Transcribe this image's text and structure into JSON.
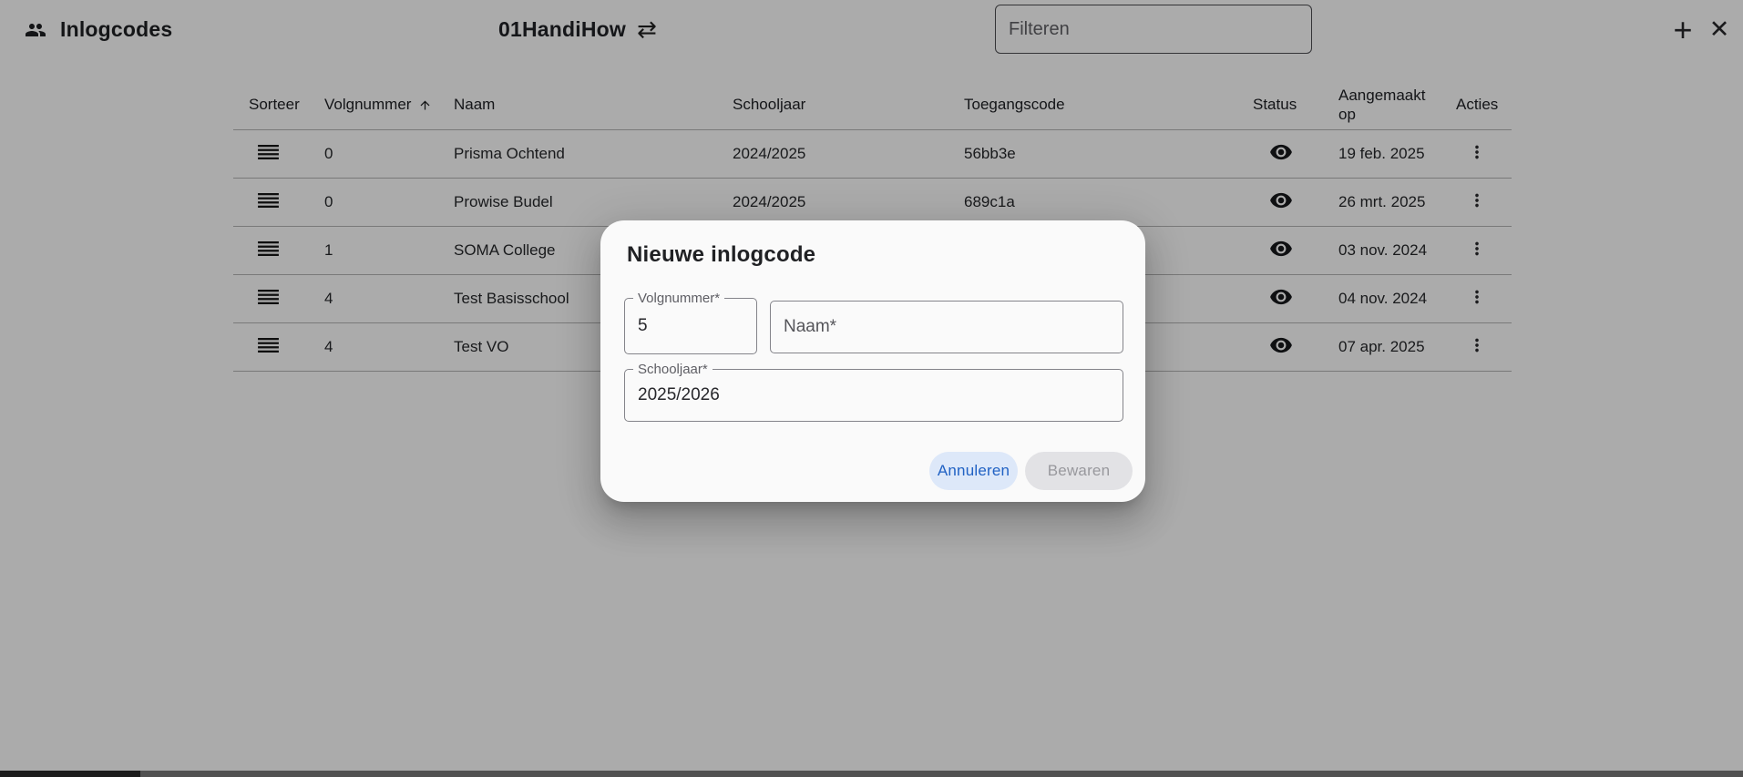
{
  "app": {
    "title": "Inlogcodes",
    "org": "01HandiHow",
    "filter_placeholder": "Filteren"
  },
  "icons": {
    "app_icon": "people",
    "org_switch_glyph": "⇄",
    "add_glyph": "+",
    "close_glyph": "✕",
    "sort_icon": "arrow-upward",
    "row_drag_icon": "drag-handle",
    "status_icon": "eye-visibility",
    "actions_icon": "kebab-more-vert"
  },
  "table": {
    "headers": [
      "Sorteer",
      "Volgnummer",
      "Naam",
      "Schooljaar",
      "Toegangscode",
      "Status",
      "Aangemaakt op",
      "Acties"
    ],
    "sorted_by": "Volgnummer",
    "sort_direction": "asc",
    "rows": [
      {
        "volgnummer": "0",
        "naam": "Prisma Ochtend",
        "schooljaar": "2024/2025",
        "toegangscode": "56bb3e",
        "aangemaakt_op": "19 feb. 2025"
      },
      {
        "volgnummer": "0",
        "naam": "Prowise Budel",
        "schooljaar": "2024/2025",
        "toegangscode": "689c1a",
        "aangemaakt_op": "26 mrt. 2025"
      },
      {
        "volgnummer": "1",
        "naam": "SOMA College",
        "schooljaar": "",
        "toegangscode": "",
        "aangemaakt_op": "03 nov. 2024"
      },
      {
        "volgnummer": "4",
        "naam": "Test Basisschool",
        "schooljaar": "",
        "toegangscode": "",
        "aangemaakt_op": "04 nov. 2024"
      },
      {
        "volgnummer": "4",
        "naam": "Test VO",
        "schooljaar": "",
        "toegangscode": "",
        "aangemaakt_op": "07 apr. 2025"
      }
    ]
  },
  "modal": {
    "title": "Nieuwe inlogcode",
    "fields": {
      "volgnummer": {
        "label": "Volgnummer*",
        "value": "5"
      },
      "naam": {
        "placeholder": "Naam*",
        "value": ""
      },
      "schooljaar": {
        "label": "Schooljaar*",
        "value": "2025/2026"
      }
    },
    "buttons": {
      "cancel": "Annuleren",
      "save": "Bewaren"
    }
  },
  "colors": {
    "accent_blue": "#2162c4",
    "cancel_button_bg": "#dde8f9",
    "save_button_bg": "#e2e2e5",
    "save_button_text": "#98989d",
    "modal_bg": "#fafafa",
    "overlay": "rgba(0,0,0,0.33)",
    "table_border": "#b5b5b5"
  }
}
